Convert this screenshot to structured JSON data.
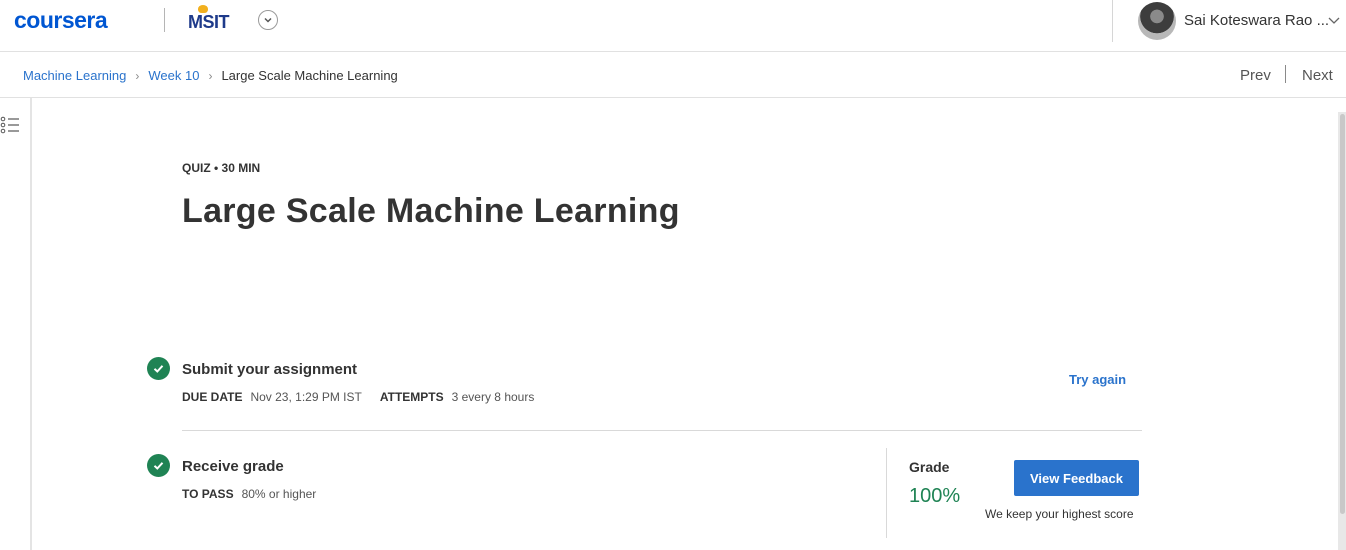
{
  "header": {
    "logo": "coursera",
    "partner_logo": "MSIT",
    "user_name": "Sai Koteswara Rao ..."
  },
  "breadcrumb": {
    "items": [
      "Machine Learning",
      "Week 10"
    ],
    "current": "Large Scale Machine Learning"
  },
  "nav": {
    "prev": "Prev",
    "next": "Next"
  },
  "quiz": {
    "meta": "QUIZ • 30 MIN",
    "title": "Large Scale Machine Learning"
  },
  "submit": {
    "title": "Submit your assignment",
    "due_label": "DUE DATE",
    "due_value": "Nov 23, 1:29 PM IST",
    "attempts_label": "ATTEMPTS",
    "attempts_value": "3 every 8 hours",
    "try_again": "Try again"
  },
  "receive": {
    "title": "Receive grade",
    "pass_label": "TO PASS",
    "pass_value": "80% or higher",
    "grade_label": "Grade",
    "grade_value": "100%",
    "feedback_button": "View Feedback",
    "highest_note": "We keep your highest score"
  },
  "colors": {
    "brand_blue": "#0056d2",
    "link_blue": "#2a73cc",
    "success_green": "#1f8354"
  },
  "icons": {
    "menu": "list-icon",
    "check": "check-circle-icon",
    "chevron": "chevron-down-icon"
  }
}
